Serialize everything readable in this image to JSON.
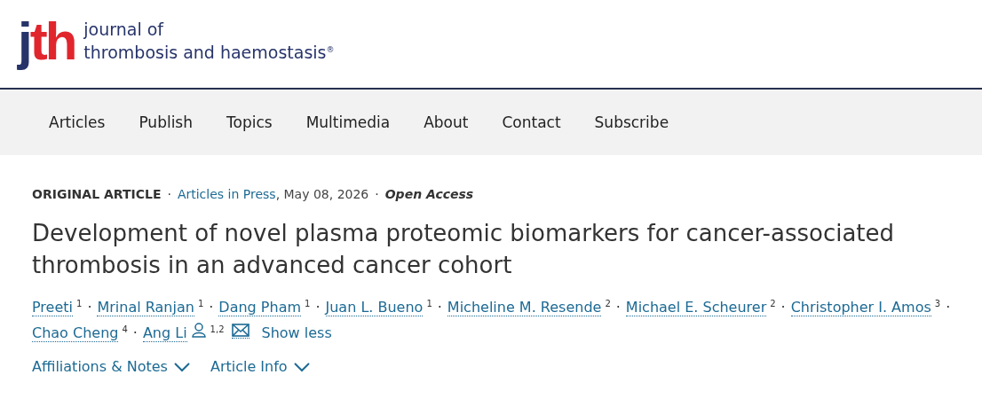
{
  "logo": {
    "mark_parts": [
      {
        "text": "j",
        "color": "#27346a"
      },
      {
        "text": "th",
        "color": "#e1252d"
      }
    ],
    "lines": [
      "journal of",
      "thrombosis and haemostasis$^{®}$"
    ]
  },
  "nav": {
    "items": [
      {
        "label": "Articles"
      },
      {
        "label": "Publish"
      },
      {
        "label": "Topics"
      },
      {
        "label": "Multimedia"
      },
      {
        "label": "About"
      },
      {
        "label": "Contact"
      },
      {
        "label": "Subscribe"
      }
    ]
  },
  "article": {
    "meta": {
      "type": "ORIGINAL ARTICLE",
      "separator": "·",
      "issue_link": "Articles in Press",
      "date": ", May 08, 2026",
      "access": "Open Access"
    },
    "title": "Development of novel plasma proteomic biomarkers for cancer-associated thrombosis in an advanced cancer cohort",
    "authors": {
      "separator": "·",
      "show_less": "Show less",
      "items": [
        {
          "name": "Preeti",
          "affiliation": "1",
          "corresponding": false
        },
        {
          "name": "Mrinal Ranjan",
          "affiliation": "1",
          "corresponding": false
        },
        {
          "name": "Dang Pham",
          "affiliation": "1",
          "corresponding": false
        },
        {
          "name": "Juan L. Bueno",
          "affiliation": "1",
          "corresponding": false
        },
        {
          "name": "Micheline M. Resende",
          "affiliation": "2",
          "corresponding": false
        },
        {
          "name": "Michael E. Scheurer",
          "affiliation": "2",
          "corresponding": false
        },
        {
          "name": "Christopher I. Amos",
          "affiliation": "3",
          "corresponding": false
        },
        {
          "name": "Chao Cheng",
          "affiliation": "4",
          "corresponding": false
        },
        {
          "name": "Ang Li",
          "affiliation": "1,2",
          "corresponding": true
        }
      ]
    },
    "sections": [
      {
        "label": "Affiliations & Notes",
        "expanded": false
      },
      {
        "label": "Article Info",
        "expanded": false
      }
    ]
  }
}
